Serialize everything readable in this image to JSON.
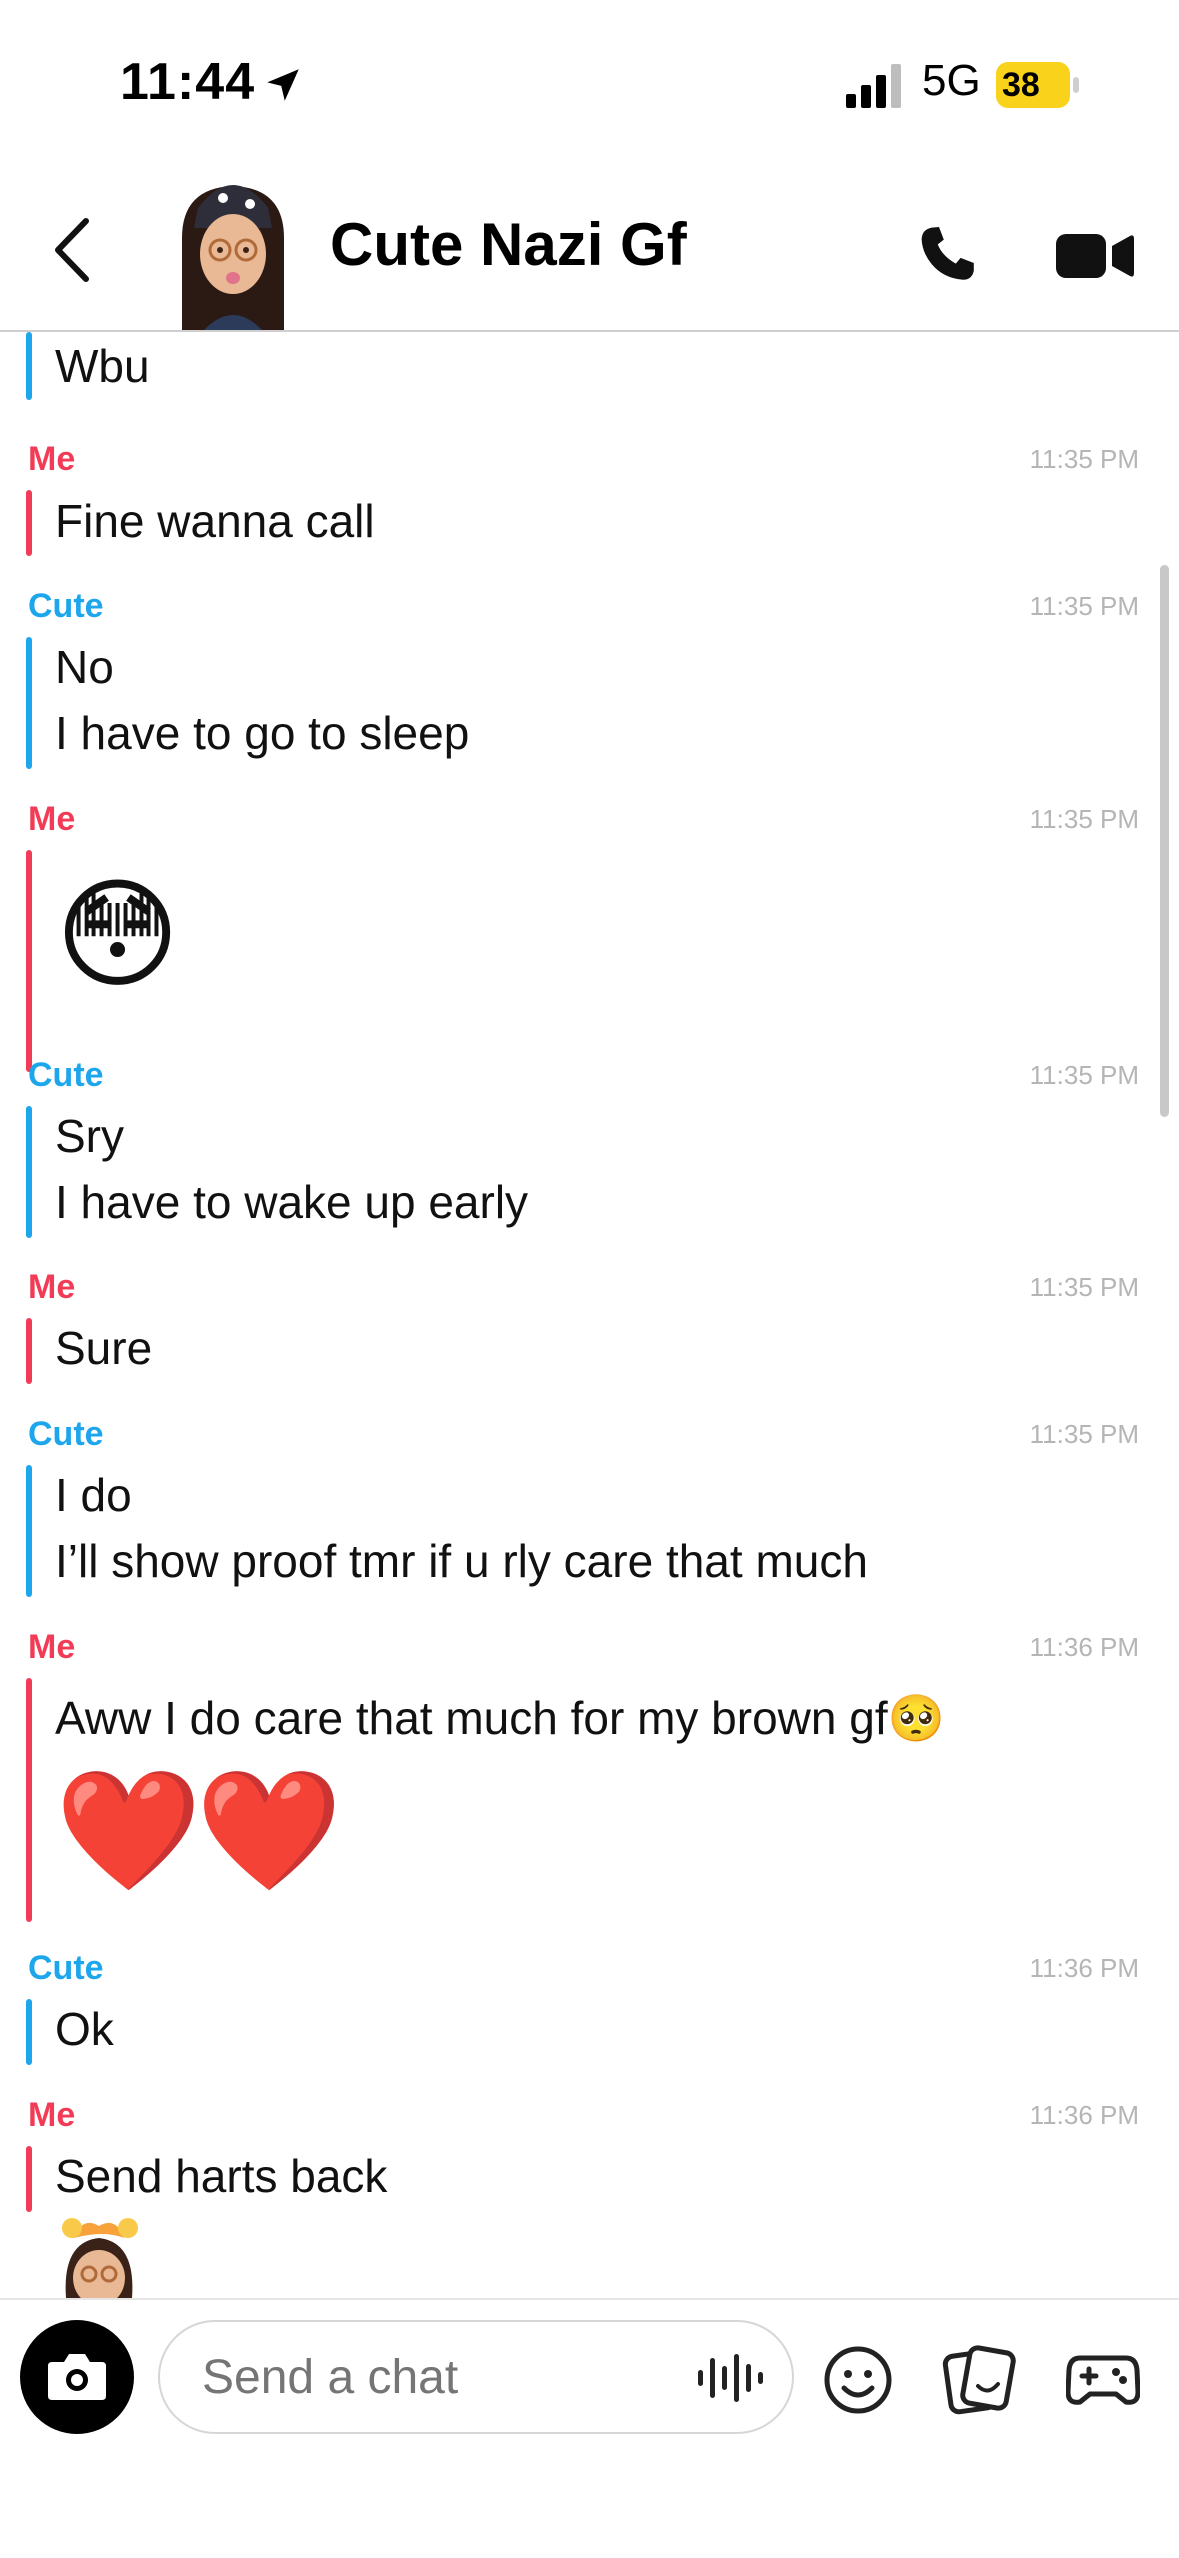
{
  "status_bar": {
    "time": "11:44",
    "network": "5G",
    "battery": "38",
    "icons": [
      "location-arrow-icon",
      "signal-icon",
      "battery-charging-icon"
    ]
  },
  "header": {
    "title": "Cute Nazi Gf",
    "icons": [
      "back-chevron-icon",
      "bitmoji-avatar",
      "phone-call-icon",
      "video-call-icon"
    ]
  },
  "chat": {
    "messages": [
      {
        "sender": "",
        "time": "",
        "lines": [
          "Wbu"
        ]
      },
      {
        "sender": "Me",
        "time": "11:35 PM",
        "lines": [
          "Fine wanna call"
        ]
      },
      {
        "sender": "Cute",
        "time": "11:35 PM",
        "lines": [
          "No",
          "I have to go to sleep"
        ]
      },
      {
        "sender": "Me",
        "time": "11:35 PM",
        "lines": [
          "😳"
        ]
      },
      {
        "sender": "Cute",
        "time": "11:35 PM",
        "lines": [
          "Sry",
          "I have to wake up early"
        ]
      },
      {
        "sender": "Me",
        "time": "11:35 PM",
        "lines": [
          "Sure"
        ]
      },
      {
        "sender": "Cute",
        "time": "11:35 PM",
        "lines": [
          "I do",
          "I’ll show proof tmr if u rly care that much"
        ]
      },
      {
        "sender": "Me",
        "time": "11:36 PM",
        "lines": [
          "Aww I do care that much for my brown gf🥺",
          "❤️❤️"
        ]
      },
      {
        "sender": "Cute",
        "time": "11:36 PM",
        "lines": [
          "Ok"
        ]
      },
      {
        "sender": "Me",
        "time": "11:36 PM",
        "lines": [
          "Send harts back"
        ]
      }
    ]
  },
  "colors": {
    "me": "#F23C57",
    "cute": "#1DA6EC",
    "battery": "#F8D21B",
    "timestamp": "#B5B5B5"
  },
  "input_bar": {
    "placeholder": "Send a chat",
    "icons": [
      "camera-icon",
      "voice-waveform-icon",
      "emoji-icon",
      "sticker-icon",
      "games-icon"
    ]
  }
}
